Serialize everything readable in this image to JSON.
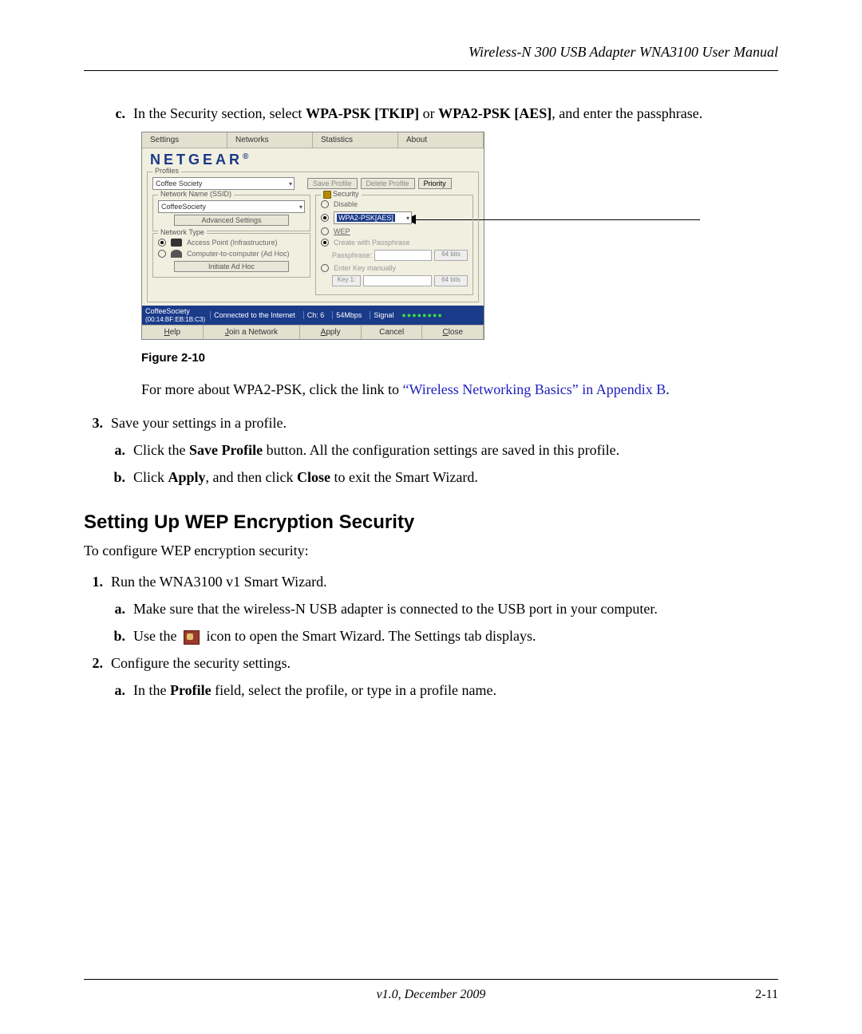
{
  "header": {
    "title": "Wireless-N 300 USB Adapter WNA3100 User Manual"
  },
  "step_c": {
    "marker": "c.",
    "pre": "In the Security section, select ",
    "opt1": "WPA-PSK [TKIP]",
    "mid": " or ",
    "opt2": "WPA2-PSK [AES]",
    "post": ", and enter the passphrase."
  },
  "figure": {
    "caption": "Figure 2-10"
  },
  "screenshot": {
    "tabs": {
      "settings": "Settings",
      "networks": "Networks",
      "statistics": "Statistics",
      "about": "About"
    },
    "brand": "NETGEAR",
    "profiles": {
      "label": "Profiles",
      "selected": "Coffee Society",
      "save": "Save Profile",
      "delete": "Delete Profile",
      "priority": "Priority"
    },
    "ssid": {
      "label": "Network Name (SSID)",
      "value": "CoffeeSociety",
      "adv": "Advanced Settings"
    },
    "nettype": {
      "label": "Network Type",
      "ap": "Access Point (Infrastructure)",
      "adhoc": "Computer-to-computer (Ad Hoc)",
      "initiate": "Initiate Ad Hoc"
    },
    "security": {
      "label": "Security",
      "disable": "Disable",
      "selected": "WPA2-PSK[AES]",
      "wep": "WEP",
      "create": "Create with Passphrase",
      "pass_label": "Passphrase:",
      "bits1": "64 bits",
      "enter": "Enter Key manually",
      "key1": "Key 1:",
      "bits2": "64 bits"
    },
    "status": {
      "name": "CoffeeSociety",
      "mac": "(00:14:BF:EB:1B:C3)",
      "conn": "Connected to the Internet",
      "ch_label": "Ch:",
      "ch": "6",
      "rate": "54Mbps",
      "signal": "Signal"
    },
    "bottom": {
      "help": "Help",
      "join": "Join a Network",
      "apply": "Apply",
      "cancel": "Cancel",
      "close": "Close"
    }
  },
  "para_after_fig": {
    "pre": "For more about WPA2-PSK, click the link to ",
    "link": "“Wireless Networking Basics” in Appendix B",
    "post": "."
  },
  "step3": {
    "marker": "3.",
    "text": "Save your settings in a profile.",
    "a": {
      "marker": "a.",
      "pre": "Click the ",
      "b1": "Save Profile",
      "post": " button. All the configuration settings are saved in this profile."
    },
    "b": {
      "marker": "b.",
      "pre": "Click ",
      "b1": "Apply",
      "mid": ", and then click ",
      "b2": "Close",
      "post": " to exit the Smart Wizard."
    }
  },
  "h2": "Setting Up WEP Encryption Security",
  "intro": "To configure WEP encryption security:",
  "wep1": {
    "marker": "1.",
    "text": "Run the WNA3100 v1 Smart Wizard.",
    "a": {
      "marker": "a.",
      "text": "Make sure that the wireless-N USB adapter is connected to the USB port in your computer."
    },
    "b": {
      "marker": "b.",
      "pre": "Use the ",
      "post": " icon to open the Smart Wizard. The Settings tab displays."
    }
  },
  "wep2": {
    "marker": "2.",
    "text": "Configure the security settings.",
    "a": {
      "marker": "a.",
      "pre": "In the ",
      "b1": "Profile",
      "post": " field, select the profile, or type in a profile name."
    }
  },
  "footer": {
    "version": "v1.0, December 2009",
    "page": "2-11"
  }
}
